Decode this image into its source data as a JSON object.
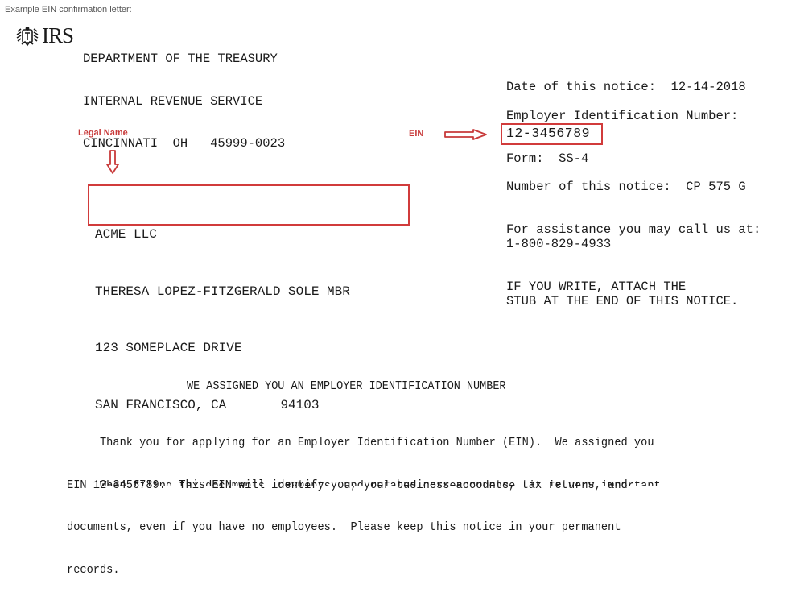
{
  "caption": "Example EIN confirmation letter:",
  "letterhead": {
    "logo_icon": "irs-eagle-icon",
    "logo_text": "IRS",
    "lines": [
      "DEPARTMENT OF THE TREASURY",
      "INTERNAL REVENUE SERVICE",
      "CINCINNATI  OH   45999-0023"
    ]
  },
  "annotations": {
    "legal_name_label": "Legal Name",
    "legal_name_arrow_icon": "arrow-down-outline-icon",
    "ein_label": "EIN",
    "ein_arrow_icon": "arrow-right-outline-icon",
    "highlight_color": "#d13b3b"
  },
  "notice_info": {
    "date_line": "Date of this notice:  12-14-2018",
    "ein_label": "Employer Identification Number:",
    "ein_value": "12-3456789",
    "form_line": "Form:  SS-4",
    "notice_number_line": "Number of this notice:  CP 575 G",
    "assistance_line": "For assistance you may call us at:",
    "phone": "1-800-829-4933",
    "write_line_1": "IF YOU WRITE, ATTACH THE",
    "write_line_2": "STUB AT THE END OF THIS NOTICE."
  },
  "recipient": {
    "legal_name_lines": [
      "ACME LLC",
      "THERESA LOPEZ-FITZGERALD SOLE MBR"
    ],
    "address_lines": [
      "123 SOMEPLACE DRIVE",
      "SAN FRANCISCO, CA       94103"
    ]
  },
  "letter_body": {
    "heading": "WE ASSIGNED YOU AN EMPLOYER IDENTIFICATION NUMBER",
    "paragraph_lines": [
      "     Thank you for applying for an Employer Identification Number (EIN).  We assigned you",
      "EIN 12-3456789.  This EIN will identify you, your business accounts, tax returns, and",
      "documents, even if you have no employees.  Please keep this notice in your permanent",
      "records."
    ],
    "truncated_line": "     When filing tax documents, payments, and related correspondence, it is very important"
  }
}
